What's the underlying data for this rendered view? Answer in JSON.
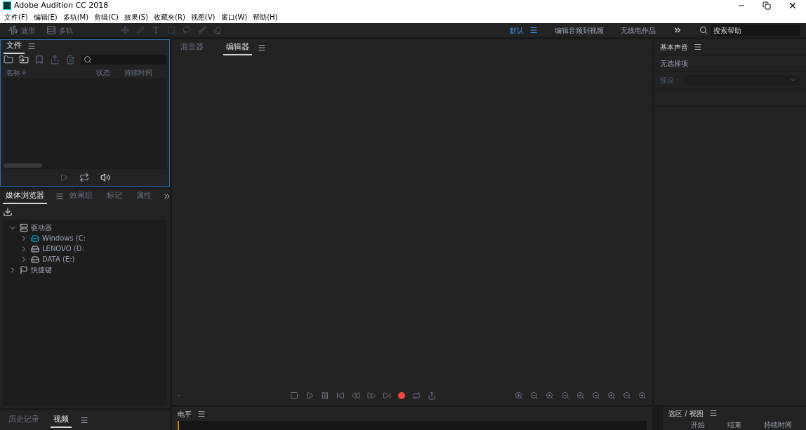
{
  "window": {
    "title": "Adobe Audition CC 2018"
  },
  "menu": [
    "文件(F)",
    "编辑(E)",
    "多轨(M)",
    "剪辑(C)",
    "效果(S)",
    "收藏夹(R)",
    "视图(V)",
    "窗口(W)",
    "帮助(H)"
  ],
  "toolbar": {
    "modes": [
      {
        "label": "波形",
        "kind": "waveform"
      },
      {
        "label": "多轨",
        "kind": "multitrack"
      }
    ],
    "workspaces": [
      {
        "label": "默认",
        "selected": true
      },
      {
        "label": "编辑音频到视频",
        "selected": false
      },
      {
        "label": "无线电作品",
        "selected": false
      }
    ],
    "search": {
      "placeholder": "搜索帮助"
    }
  },
  "files_panel": {
    "focused": true,
    "tabs": [
      {
        "label": "文件",
        "selected": true
      }
    ],
    "columns": [
      "名称",
      "状态",
      "持续时间"
    ]
  },
  "media_browser": {
    "tabs": [
      {
        "label": "媒体浏览器",
        "selected": true
      },
      {
        "label": "效果组",
        "selected": false
      },
      {
        "label": "标记",
        "selected": false
      },
      {
        "label": "属性",
        "selected": false
      }
    ],
    "tree": [
      {
        "label": "驱动器",
        "kind": "drives",
        "expanded": true,
        "children": [
          {
            "label": "Windows (C:",
            "kind": "system-drive",
            "expanded": false
          },
          {
            "label": "LENOVO (D:",
            "kind": "drive",
            "expanded": false
          },
          {
            "label": "DATA (E:)",
            "kind": "drive",
            "expanded": false
          }
        ]
      },
      {
        "label": "快捷键",
        "kind": "shortcuts",
        "expanded": false
      }
    ]
  },
  "history_panel": {
    "tabs": [
      {
        "label": "历史记录",
        "selected": false
      },
      {
        "label": "视频",
        "selected": true
      }
    ]
  },
  "editor": {
    "tabs": [
      {
        "label": "混音器",
        "selected": false
      },
      {
        "label": "编辑器",
        "selected": true
      }
    ],
    "time": "-"
  },
  "levels_panel": {
    "title": "电平"
  },
  "essential_sound": {
    "title": "基本声音",
    "message": "无选择项",
    "preset": {
      "label": "预设：",
      "disabled": true
    }
  },
  "selection_view": {
    "title": "选区 / 视图",
    "columns": [
      "开始",
      "结束",
      "持续时间"
    ]
  }
}
